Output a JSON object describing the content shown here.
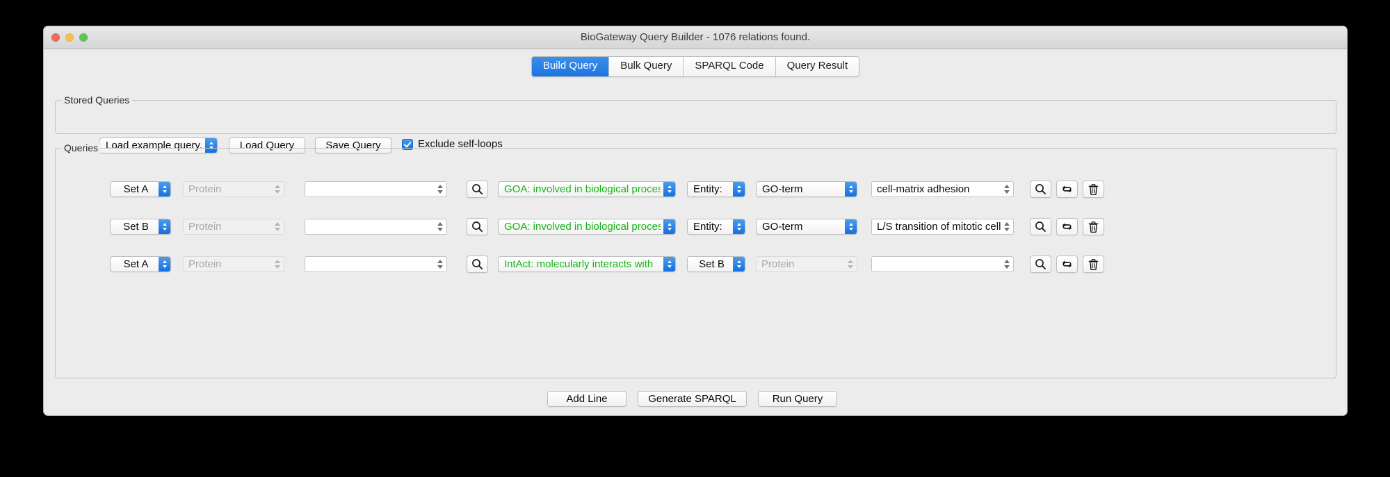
{
  "window": {
    "title": "BioGateway Query Builder - 1076 relations found.",
    "traffic_lights": [
      "close",
      "minimize",
      "zoom"
    ]
  },
  "tabs": [
    {
      "label": "Build Query",
      "active": true
    },
    {
      "label": "Bulk Query",
      "active": false
    },
    {
      "label": "SPARQL Code",
      "active": false
    },
    {
      "label": "Query Result",
      "active": false
    }
  ],
  "stored_queries": {
    "legend": "Stored Queries",
    "example_select": "Load example query...",
    "load_button": "Load Query",
    "save_button": "Save Query",
    "exclude_self_loops_label": "Exclude self-loops",
    "exclude_self_loops_checked": true
  },
  "queries": {
    "legend": "Queries",
    "rows": [
      {
        "subject_set": "Set A",
        "subject_type": "Protein",
        "subject_type_disabled": true,
        "subject_value": "",
        "relation": "GOA: involved in biological process",
        "relation_color": "#16b516",
        "object_mode": "Entity:",
        "object_type": "GO-term",
        "object_type_disabled": false,
        "object_value": "cell-matrix adhesion",
        "object_value_disabled": false
      },
      {
        "subject_set": "Set B",
        "subject_type": "Protein",
        "subject_type_disabled": true,
        "subject_value": "",
        "relation": "GOA: involved in biological process",
        "relation_color": "#16b516",
        "object_mode": "Entity:",
        "object_type": "GO-term",
        "object_type_disabled": false,
        "object_value": "L/S transition of mitotic cell cycle",
        "object_value_disabled": false
      },
      {
        "subject_set": "Set A",
        "subject_type": "Protein",
        "subject_type_disabled": true,
        "subject_value": "",
        "relation": "IntAct: molecularly interacts with",
        "relation_color": "#16b516",
        "object_mode": "Set B",
        "object_type": "Protein",
        "object_type_disabled": true,
        "object_value": "",
        "object_value_disabled": false
      }
    ],
    "row_icons": {
      "search": "search-icon",
      "swap": "refresh-swap-icon",
      "delete": "trash-icon"
    }
  },
  "footer": {
    "add_line": "Add Line",
    "generate_sparql": "Generate SPARQL",
    "run_query": "Run Query"
  },
  "colors": {
    "accent_blue": "#1470e0",
    "relation_green": "#16b516",
    "window_bg": "#ececec",
    "desktop_bg": "#000000"
  }
}
